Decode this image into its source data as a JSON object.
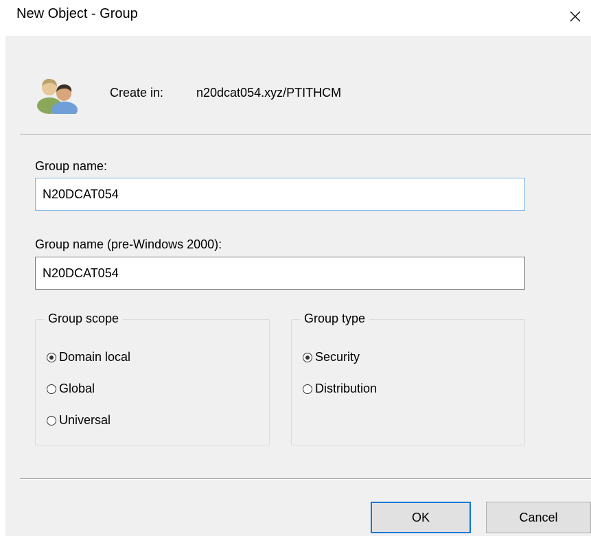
{
  "window": {
    "title": "New Object - Group",
    "close_glyph": "✕"
  },
  "header": {
    "icon": "user-group-icon",
    "create_in_label": "Create in:",
    "create_in_path": "n20dcat054.xyz/PTITHCM"
  },
  "fields": {
    "group_name_label": "Group name:",
    "group_name_value": "N20DCAT054",
    "group_name_pre2000_label": "Group name (pre-Windows 2000):",
    "group_name_pre2000_value": "N20DCAT054"
  },
  "group_scope": {
    "legend": "Group scope",
    "options": [
      {
        "label": "Domain local",
        "checked": true
      },
      {
        "label": "Global",
        "checked": false
      },
      {
        "label": "Universal",
        "checked": false
      }
    ]
  },
  "group_type": {
    "legend": "Group type",
    "options": [
      {
        "label": "Security",
        "checked": true
      },
      {
        "label": "Distribution",
        "checked": false
      }
    ]
  },
  "buttons": {
    "ok": "OK",
    "cancel": "Cancel"
  },
  "colors": {
    "dialog_bg": "#f0f0f0",
    "focus_accent": "#0078d7",
    "input_focus_border": "#7eb4ea"
  }
}
